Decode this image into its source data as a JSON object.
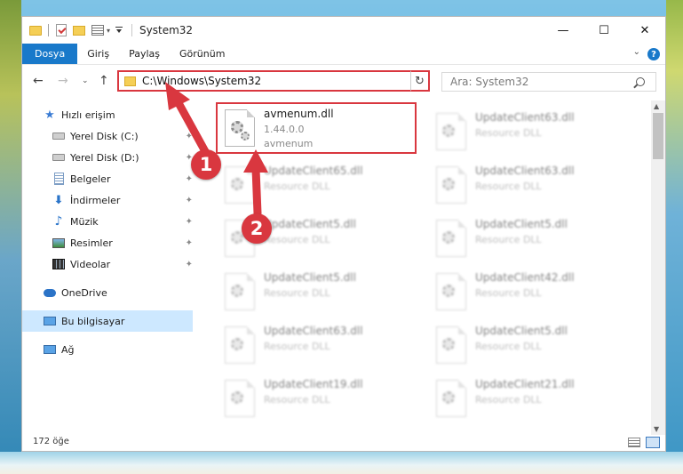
{
  "titlebar": {
    "title": "System32"
  },
  "window_controls": {
    "minimize": "—",
    "maximize": "☐",
    "close": "✕"
  },
  "ribbon": {
    "tabs": [
      {
        "label": "Dosya",
        "active": true
      },
      {
        "label": "Giriş"
      },
      {
        "label": "Paylaş"
      },
      {
        "label": "Görünüm"
      }
    ],
    "help": "?"
  },
  "nav": {
    "address": "C:\\Windows\\System32",
    "search_placeholder": "Ara: System32"
  },
  "sidebar": {
    "items": [
      {
        "label": "Hızlı erişim",
        "icon": "quick-access-star-icon"
      },
      {
        "label": "Yerel Disk (C:)",
        "icon": "drive-icon",
        "pinned": true
      },
      {
        "label": "Yerel Disk (D:)",
        "icon": "drive-icon",
        "pinned": true
      },
      {
        "label": "Belgeler",
        "icon": "documents-icon",
        "pinned": true
      },
      {
        "label": "İndirmeler",
        "icon": "downloads-icon",
        "pinned": true
      },
      {
        "label": "Müzik",
        "icon": "music-icon",
        "pinned": true
      },
      {
        "label": "Resimler",
        "icon": "pictures-icon",
        "pinned": true
      },
      {
        "label": "Videolar",
        "icon": "videos-icon",
        "pinned": true
      },
      {
        "label": "OneDrive",
        "icon": "onedrive-cloud-icon"
      },
      {
        "label": "Bu bilgisayar",
        "icon": "this-pc-icon",
        "selected": true
      },
      {
        "label": "Ağ",
        "icon": "network-icon"
      }
    ]
  },
  "files": {
    "focused": {
      "name": "avmenum.dll",
      "version": "1.44.0.0",
      "desc": "avmenum"
    },
    "col1": [
      {
        "name": "UpdateClient65.dll",
        "desc": "Resource DLL"
      },
      {
        "name": "UpdateClient5.dll",
        "desc": "Resource DLL"
      },
      {
        "name": "UpdateClient5.dll",
        "desc": "Resource DLL"
      },
      {
        "name": "UpdateClient63.dll",
        "desc": "Resource DLL"
      },
      {
        "name": "UpdateClient19.dll",
        "desc": "Resource DLL"
      }
    ],
    "col2": [
      {
        "name": "UpdateClient63.dll",
        "desc": "Resource DLL"
      },
      {
        "name": "UpdateClient63.dll",
        "desc": "Resource DLL"
      },
      {
        "name": "UpdateClient5.dll",
        "desc": "Resource DLL"
      },
      {
        "name": "UpdateClient42.dll",
        "desc": "Resource DLL"
      },
      {
        "name": "UpdateClient5.dll",
        "desc": "Resource DLL"
      },
      {
        "name": "UpdateClient21.dll",
        "desc": "Resource DLL"
      }
    ]
  },
  "status": {
    "count": "172 öğe"
  },
  "callouts": {
    "one": "1",
    "two": "2"
  },
  "colors": {
    "accent": "#1979ca",
    "highlight": "#d9373f",
    "selected": "#cde8ff"
  }
}
